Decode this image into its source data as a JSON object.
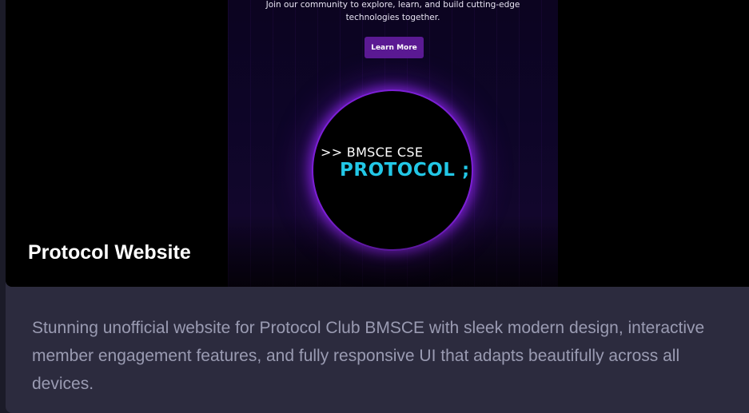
{
  "project": {
    "title": "Protocol Website",
    "description": "Stunning unofficial website for Protocol Club BMSCE with sleek modern design, interactive member engagement features, and fully responsive UI that adapts beautifully across all devices."
  },
  "preview": {
    "tagline_line1": "Join our community to explore, learn, and build cutting-edge",
    "tagline_line2": "technologies together.",
    "cta_label": "Learn More",
    "logo_line1": ">> BMSCE CSE",
    "logo_line2": "PROTOCOL ;"
  },
  "colors": {
    "accent_purple": "#7c1fd6",
    "logo_cyan": "#22c7e6",
    "card_bg": "#2c2b3e",
    "description_text": "#9a9bb2"
  }
}
